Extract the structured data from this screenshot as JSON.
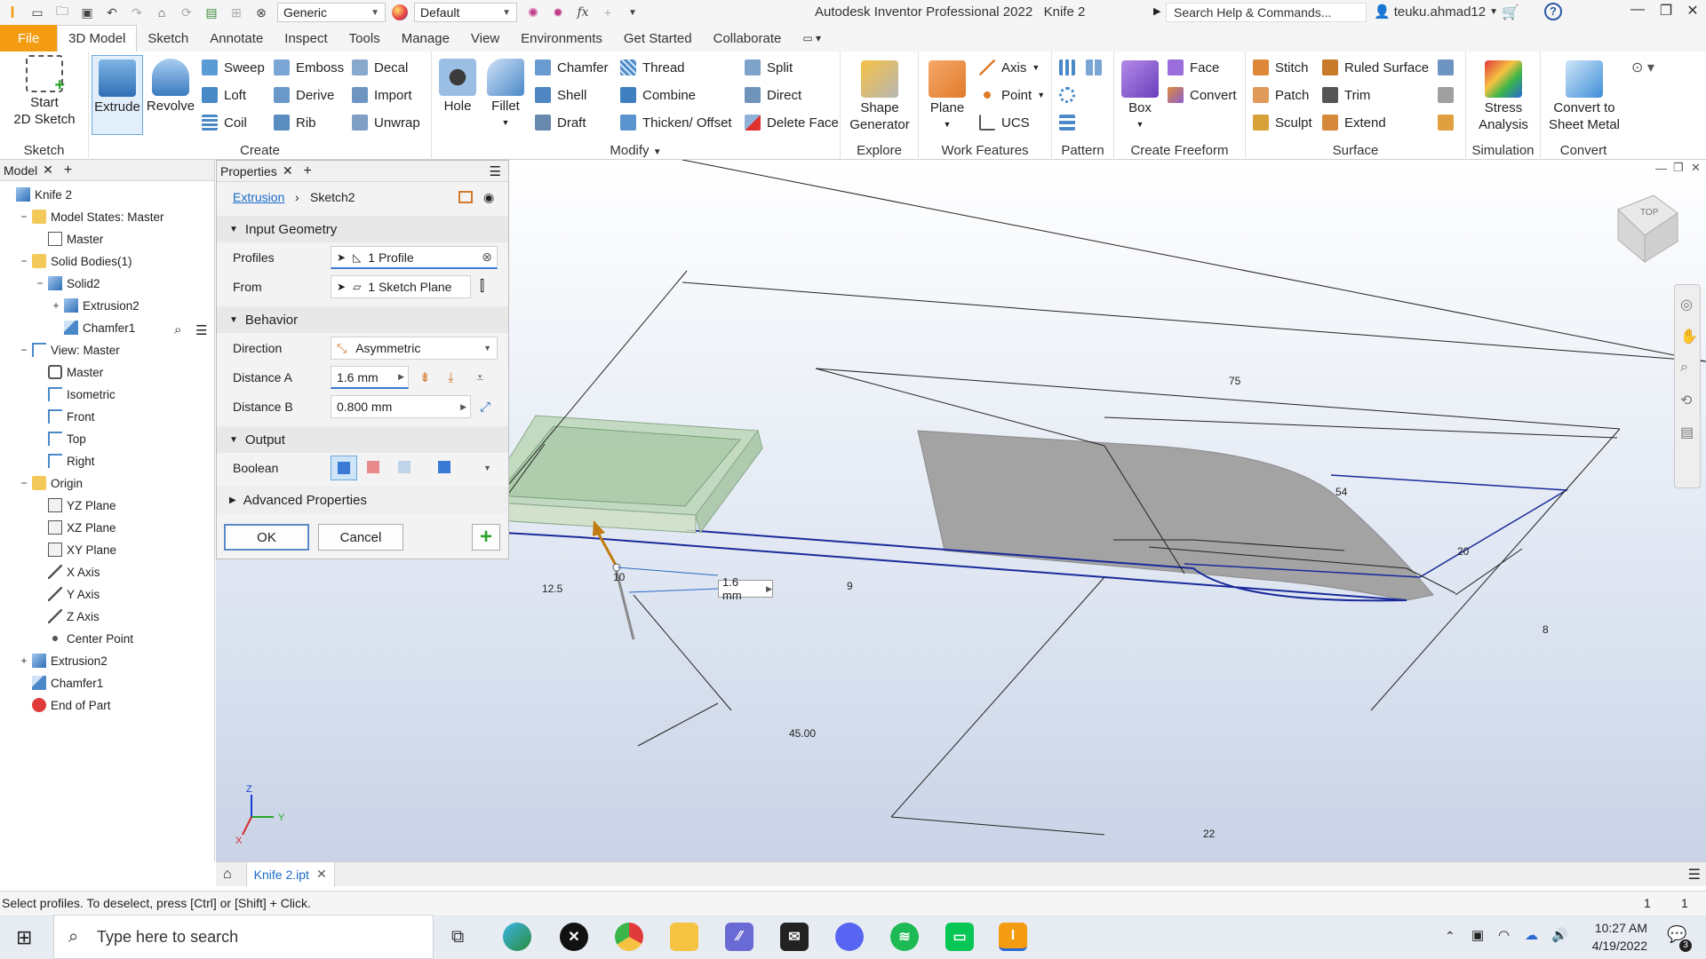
{
  "titlebar": {
    "material": "Generic",
    "appearance": "Default",
    "app_title": "Autodesk Inventor Professional 2022",
    "doc_title": "Knife 2",
    "search_placeholder": "Search Help & Commands...",
    "user": "teuku.ahmad12"
  },
  "ribbon_tabs": [
    "File",
    "3D Model",
    "Sketch",
    "Annotate",
    "Inspect",
    "Tools",
    "Manage",
    "View",
    "Environments",
    "Get Started",
    "Collaborate"
  ],
  "ribbon": {
    "sketch": {
      "label": "Sketch",
      "start_line1": "Start",
      "start_line2": "2D Sketch"
    },
    "create": {
      "label": "Create",
      "extrude": "Extrude",
      "revolve": "Revolve",
      "sweep": "Sweep",
      "loft": "Loft",
      "coil": "Coil",
      "emboss": "Emboss",
      "derive": "Derive",
      "rib": "Rib",
      "decal": "Decal",
      "import": "Import",
      "unwrap": "Unwrap"
    },
    "modify": {
      "label": "Modify",
      "hole": "Hole",
      "fillet": "Fillet",
      "chamfer": "Chamfer",
      "shell": "Shell",
      "draft": "Draft",
      "thread": "Thread",
      "combine": "Combine",
      "thicken": "Thicken/ Offset",
      "split": "Split",
      "direct": "Direct",
      "delete_face": "Delete Face"
    },
    "explore": {
      "label": "Explore",
      "shape_line1": "Shape",
      "shape_line2": "Generator"
    },
    "work_features": {
      "label": "Work Features",
      "plane": "Plane",
      "axis": "Axis",
      "point": "Point",
      "ucs": "UCS"
    },
    "pattern": {
      "label": "Pattern"
    },
    "freeform": {
      "label": "Create Freeform",
      "box": "Box",
      "face": "Face",
      "convert": "Convert"
    },
    "surface": {
      "label": "Surface",
      "stitch": "Stitch",
      "patch": "Patch",
      "sculpt": "Sculpt",
      "ruled": "Ruled Surface",
      "trim": "Trim",
      "extend": "Extend"
    },
    "simulation": {
      "label": "Simulation",
      "stress_line1": "Stress",
      "stress_line2": "Analysis"
    },
    "convert": {
      "label": "Convert",
      "sheet_line1": "Convert to",
      "sheet_line2": "Sheet Metal"
    }
  },
  "browser": {
    "tab": "Model",
    "items": [
      {
        "label": "Knife 2",
        "indent": 0,
        "toggle": "",
        "icon": "part"
      },
      {
        "label": "Model States: Master",
        "indent": 1,
        "toggle": "−",
        "icon": "folder"
      },
      {
        "label": "Master",
        "indent": 2,
        "toggle": "",
        "icon": "check"
      },
      {
        "label": "Solid Bodies(1)",
        "indent": 1,
        "toggle": "−",
        "icon": "folder"
      },
      {
        "label": "Solid2",
        "indent": 2,
        "toggle": "−",
        "icon": "solid"
      },
      {
        "label": "Extrusion2",
        "indent": 3,
        "toggle": "+",
        "icon": "solid"
      },
      {
        "label": "Chamfer1",
        "indent": 3,
        "toggle": "",
        "icon": "chamfer"
      },
      {
        "label": "View: Master",
        "indent": 1,
        "toggle": "−",
        "icon": "view"
      },
      {
        "label": "Master",
        "indent": 2,
        "toggle": "",
        "icon": "lock"
      },
      {
        "label": "Isometric",
        "indent": 2,
        "toggle": "",
        "icon": "view"
      },
      {
        "label": "Front",
        "indent": 2,
        "toggle": "",
        "icon": "view"
      },
      {
        "label": "Top",
        "indent": 2,
        "toggle": "",
        "icon": "view"
      },
      {
        "label": "Right",
        "indent": 2,
        "toggle": "",
        "icon": "view"
      },
      {
        "label": "Origin",
        "indent": 1,
        "toggle": "−",
        "icon": "folder"
      },
      {
        "label": "YZ Plane",
        "indent": 2,
        "toggle": "",
        "icon": "plane"
      },
      {
        "label": "XZ Plane",
        "indent": 2,
        "toggle": "",
        "icon": "plane"
      },
      {
        "label": "XY Plane",
        "indent": 2,
        "toggle": "",
        "icon": "plane"
      },
      {
        "label": "X Axis",
        "indent": 2,
        "toggle": "",
        "icon": "axis"
      },
      {
        "label": "Y Axis",
        "indent": 2,
        "toggle": "",
        "icon": "axis"
      },
      {
        "label": "Z Axis",
        "indent": 2,
        "toggle": "",
        "icon": "axis"
      },
      {
        "label": "Center Point",
        "indent": 2,
        "toggle": "",
        "icon": "point"
      },
      {
        "label": "Extrusion2",
        "indent": 1,
        "toggle": "+",
        "icon": "solid"
      },
      {
        "label": "Chamfer1",
        "indent": 1,
        "toggle": "",
        "icon": "chamfer"
      },
      {
        "label": "End of Part",
        "indent": 1,
        "toggle": "",
        "icon": "end"
      }
    ]
  },
  "properties": {
    "tab": "Properties",
    "crumb_feature": "Extrusion",
    "crumb_sketch": "Sketch2",
    "input_geometry": "Input Geometry",
    "profiles_label": "Profiles",
    "profiles_value": "1 Profile",
    "from_label": "From",
    "from_value": "1 Sketch Plane",
    "behavior": "Behavior",
    "direction_label": "Direction",
    "direction_value": "Asymmetric",
    "distance_a_label": "Distance A",
    "distance_a_value": "1.6 mm",
    "distance_b_label": "Distance B",
    "distance_b_value": "0.800 mm",
    "output": "Output",
    "boolean_label": "Boolean",
    "advanced": "Advanced Properties",
    "ok": "OK",
    "cancel": "Cancel"
  },
  "viewport": {
    "dims": {
      "d75": "75",
      "d54": "54",
      "d20": "20",
      "d8": "8",
      "d22": "22",
      "d12_5": "12.5",
      "d10": "10",
      "d9": "9",
      "d45": "45.00"
    },
    "distance_tag": "1.6 mm",
    "viewcube_face": "TOP",
    "axis_x": "X",
    "axis_y": "Y",
    "axis_z": "Z"
  },
  "doctab": {
    "name": "Knife 2.ipt"
  },
  "status": {
    "message": "Select profiles. To deselect, press [Ctrl] or [Shift] + Click.",
    "count1": "1",
    "count2": "1"
  },
  "taskbar": {
    "search": "Type here to search",
    "time": "10:27 AM",
    "date": "4/19/2022",
    "notifications": "3"
  }
}
